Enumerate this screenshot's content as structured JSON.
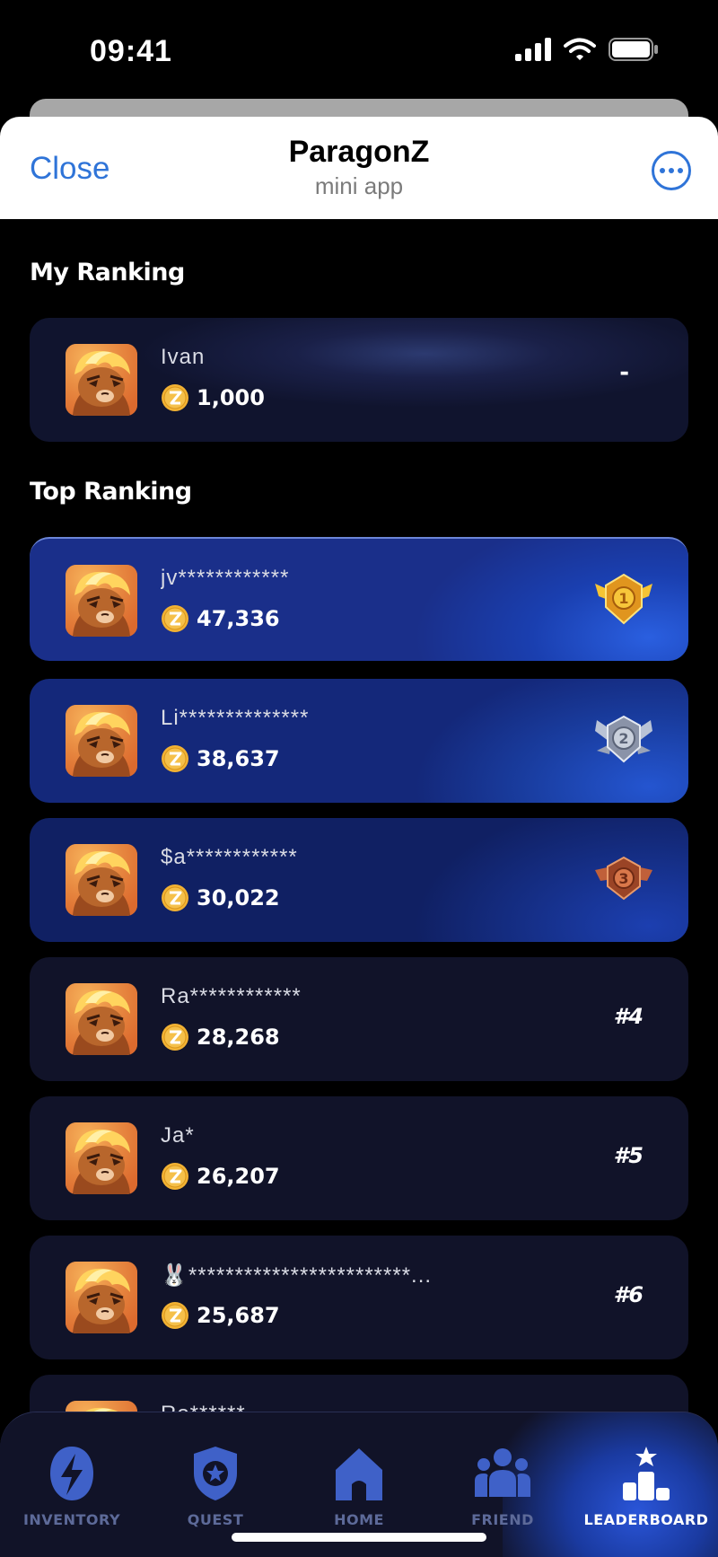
{
  "status_bar": {
    "time": "09:41"
  },
  "header": {
    "close_label": "Close",
    "title": "ParagonZ",
    "subtitle": "mini app"
  },
  "my_ranking": {
    "title": "My Ranking",
    "entry": {
      "name": "Ivan",
      "score": "1,000",
      "rank": "-"
    }
  },
  "top_ranking": {
    "title": "Top Ranking",
    "entries": [
      {
        "name": "jv************",
        "score": "47,336",
        "rank": "1",
        "medal": "gold-medal-icon"
      },
      {
        "name": "Li**************",
        "score": "38,637",
        "rank": "2",
        "medal": "silver-medal-icon"
      },
      {
        "name": "$a************",
        "score": "30,022",
        "rank": "3",
        "medal": "bronze-medal-icon"
      },
      {
        "name": "Ra************",
        "score": "28,268",
        "rank": "#4"
      },
      {
        "name": "Ja*",
        "score": "26,207",
        "rank": "#5"
      },
      {
        "name": "🐰************************...",
        "score": "25,687",
        "rank": "#6"
      },
      {
        "name": "Ro******",
        "score": "",
        "rank": ""
      }
    ]
  },
  "nav": {
    "items": [
      {
        "label": "INVENTORY",
        "icon": "lightning-icon"
      },
      {
        "label": "QUEST",
        "icon": "shield-star-icon"
      },
      {
        "label": "HOME",
        "icon": "home-icon"
      },
      {
        "label": "FRIEND",
        "icon": "friends-icon"
      },
      {
        "label": "LEADERBOARD",
        "icon": "podium-icon",
        "active": true
      }
    ]
  },
  "colors": {
    "accent_blue": "#2f74d8",
    "gold": "#f2b233",
    "nav_inactive": "#3f61c8",
    "nav_label_inactive": "#5d6a99"
  }
}
